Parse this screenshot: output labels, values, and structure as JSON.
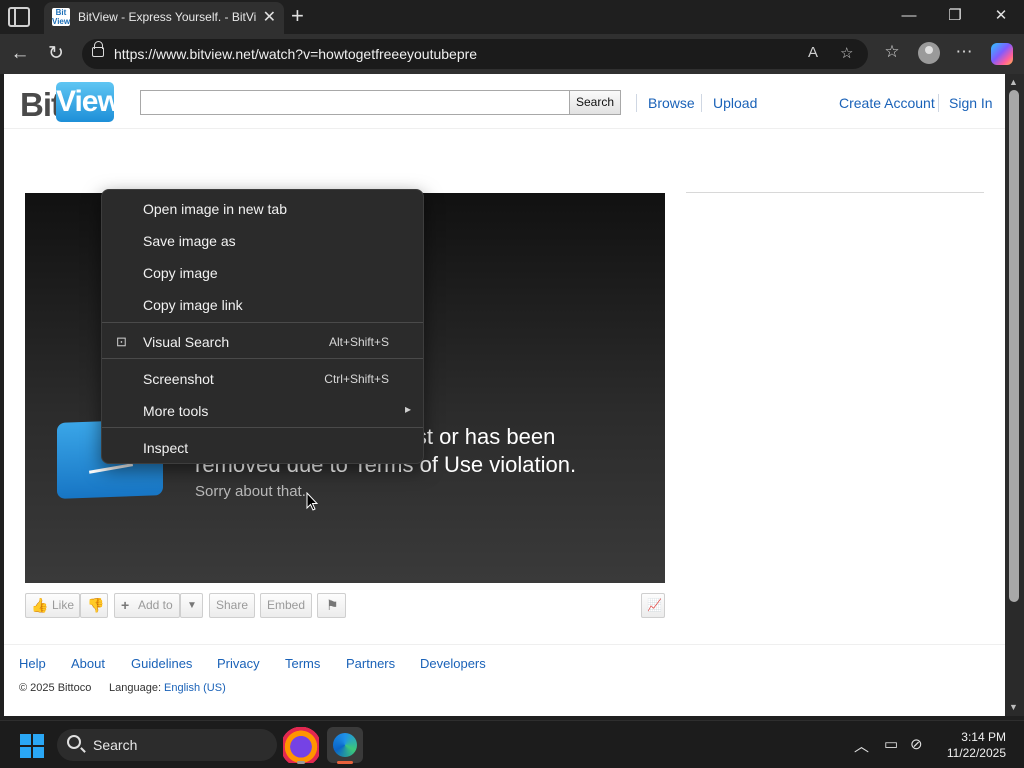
{
  "browser": {
    "tab_title": "BitView - Express Yourself. - BitView",
    "favicon_text": "Bit View",
    "url": "https://www.bitview.net/watch?v=howtogetfreeeyoutubepre"
  },
  "site": {
    "logo_bit": "Bit",
    "logo_view": "View",
    "search_button": "Search",
    "search_value": "",
    "nav": {
      "browse": "Browse",
      "upload": "Upload",
      "create_account": "Create Account",
      "sign_in": "Sign In"
    }
  },
  "player": {
    "message_line1": "xist or has been",
    "message_line2": "removed due to Terms of Use violation.",
    "message_sub": "Sorry about that."
  },
  "actions": {
    "like": "Like",
    "add_to": "Add to",
    "share": "Share",
    "embed": "Embed"
  },
  "footer": {
    "links": [
      "Help",
      "About",
      "Guidelines",
      "Privacy",
      "Terms",
      "Partners",
      "Developers"
    ],
    "copyright": "© 2025 Bittoco",
    "language_label": "Language:",
    "language_value": "English (US)"
  },
  "context_menu": {
    "open_image": "Open image in new tab",
    "save_image": "Save image as",
    "copy_image": "Copy image",
    "copy_image_link": "Copy image link",
    "visual_search": "Visual Search",
    "visual_search_shortcut": "Alt+Shift+S",
    "screenshot": "Screenshot",
    "screenshot_shortcut": "Ctrl+Shift+S",
    "more_tools": "More tools",
    "inspect": "Inspect"
  },
  "taskbar": {
    "search_text": "Search",
    "time": "3:14 PM",
    "date": "11/22/2025"
  },
  "colors": {
    "link": "#1a62b8",
    "accent": "#1d8fd8"
  }
}
